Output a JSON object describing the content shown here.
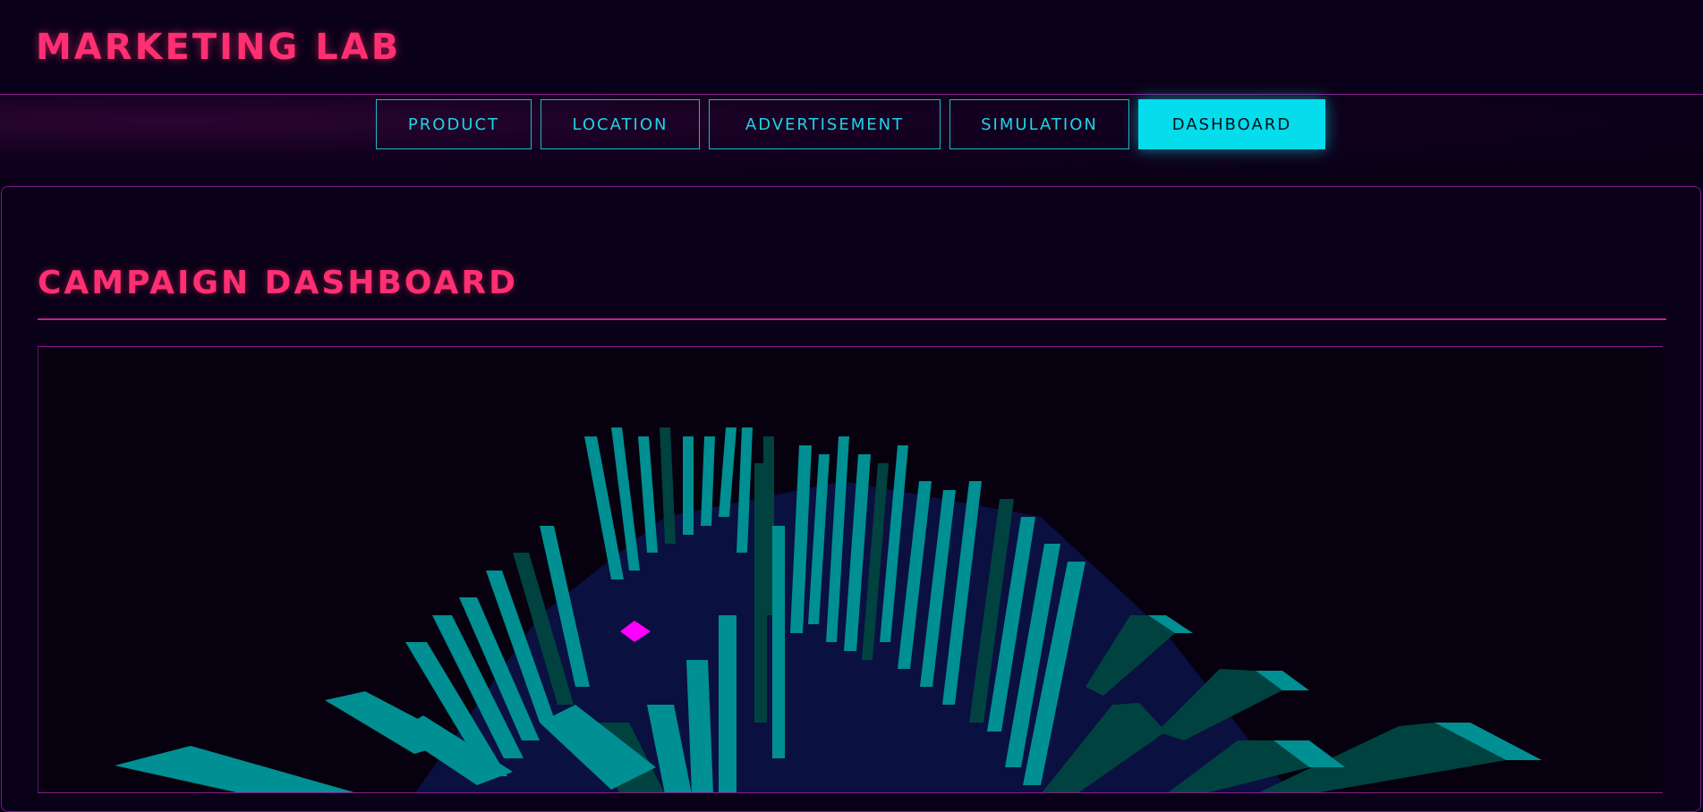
{
  "header": {
    "title": "MARKETING LAB"
  },
  "tabs": [
    {
      "label": "PRODUCT",
      "active": false
    },
    {
      "label": "LOCATION",
      "active": false
    },
    {
      "label": "ADVERTISEMENT",
      "active": false
    },
    {
      "label": "SIMULATION",
      "active": false
    },
    {
      "label": "DASHBOARD",
      "active": true
    }
  ],
  "dashboard": {
    "title": "CAMPAIGN DASHBOARD"
  },
  "colors": {
    "accent_pink": "#ff2f72",
    "accent_cyan": "#05dcec",
    "bar_teal": "#008f92",
    "bar_teal_dark": "#00423f",
    "floor_navy": "#0a1040",
    "marker_magenta": "#ff00ff"
  },
  "icons": {
    "marker": "diamond-marker-icon"
  }
}
